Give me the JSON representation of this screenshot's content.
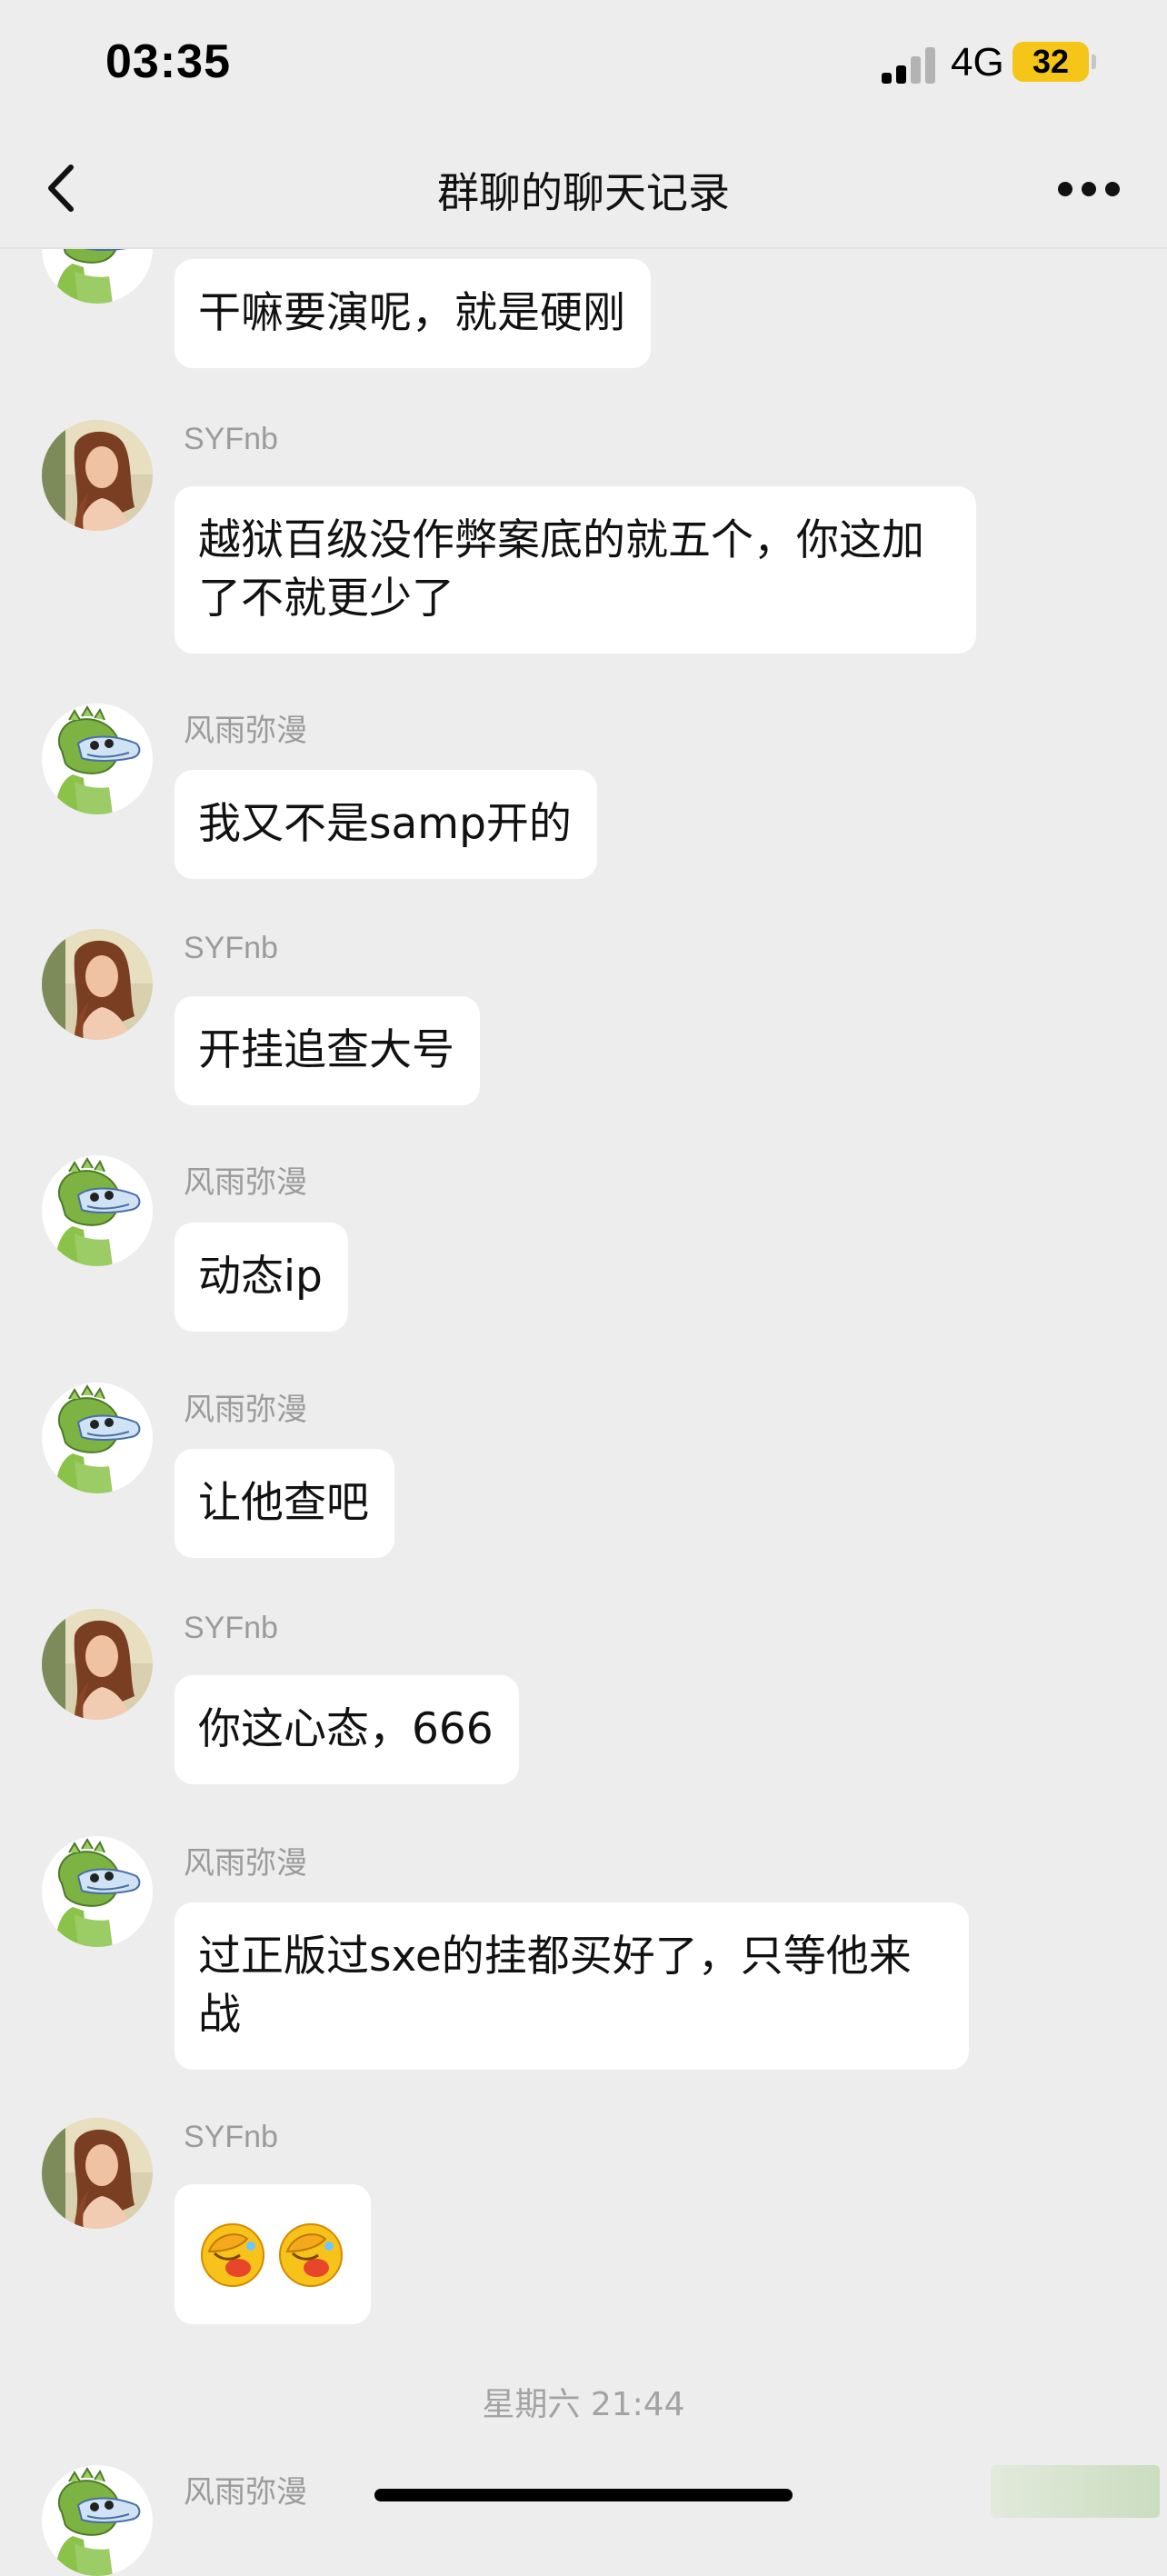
{
  "status_bar": {
    "time": "03:35",
    "network": "4G",
    "battery": "32",
    "signal_level": 0.5
  },
  "nav": {
    "back_icon": "chevron-left-icon",
    "title": "群聊的聊天记录",
    "more_icon": "ellipsis-icon"
  },
  "messages": [
    {
      "sender": "",
      "avatar": "dinosaur-avatar",
      "text": "干嘛要演呢，就是硬刚"
    },
    {
      "sender": "SYFnb",
      "avatar": "portrait-avatar",
      "text": "越狱百级没作弊案底的就五个，你这加了不就更少了"
    },
    {
      "sender": "风雨弥漫",
      "avatar": "dinosaur-avatar",
      "text": "我又不是samp开的"
    },
    {
      "sender": "SYFnb",
      "avatar": "portrait-avatar",
      "text": "开挂追查大号"
    },
    {
      "sender": "风雨弥漫",
      "avatar": "dinosaur-avatar",
      "text": "动态ip"
    },
    {
      "sender": "风雨弥漫",
      "avatar": "dinosaur-avatar",
      "text": "让他查吧"
    },
    {
      "sender": "SYFnb",
      "avatar": "portrait-avatar",
      "text": "你这心态，666"
    },
    {
      "sender": "风雨弥漫",
      "avatar": "dinosaur-avatar",
      "text": "过正版过sxe的挂都买好了，只等他来战"
    },
    {
      "sender": "SYFnb",
      "avatar": "portrait-avatar",
      "text": "",
      "emoji": "facepalm-emoji"
    }
  ],
  "timestamp": "星期六 21:44",
  "last_sender": "风雨弥漫",
  "colors": {
    "background": "#ededed",
    "bubble": "#ffffff",
    "battery": "#f5c518",
    "dinosaur": "#6aa84f"
  }
}
